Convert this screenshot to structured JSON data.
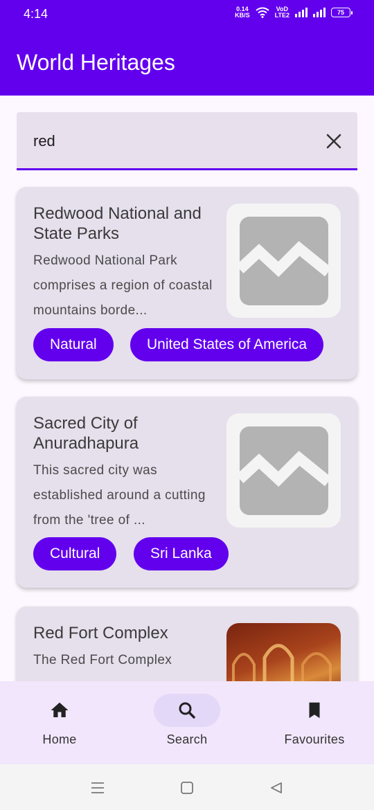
{
  "status_bar": {
    "time": "4:14",
    "net_speed_value": "0.14",
    "net_speed_unit": "KB/S",
    "volte_label_top": "VoD",
    "volte_label_bottom": "LTE2",
    "battery": "75"
  },
  "app_bar": {
    "title": "World Heritages"
  },
  "search": {
    "value": "red",
    "placeholder": ""
  },
  "results": [
    {
      "title": "Redwood National and State Parks",
      "description": "Redwood National Park comprises a region of coastal mountains borde...",
      "category": "Natural",
      "country": "United States of America",
      "image": "placeholder-image-icon"
    },
    {
      "title": "Sacred City of Anuradhapura",
      "description": "This sacred city was established around a cutting from the 'tree of ...",
      "category": "Cultural",
      "country": "Sri Lanka",
      "image": "placeholder-image-icon"
    },
    {
      "title": "Red Fort Complex",
      "description": "The Red Fort Complex",
      "image": "red-fort-photo"
    }
  ],
  "bottom_nav": {
    "items": [
      {
        "label": "Home",
        "icon": "home-icon",
        "active": false
      },
      {
        "label": "Search",
        "icon": "search-icon",
        "active": true
      },
      {
        "label": "Favourites",
        "icon": "bookmark-icon",
        "active": false
      }
    ]
  },
  "system_nav": {
    "icons": [
      "menu-icon",
      "home-square-icon",
      "back-triangle-icon"
    ]
  },
  "colors": {
    "primary": "#6200ee",
    "card": "#e6dfec",
    "nav_bg": "#f1e6fb"
  }
}
